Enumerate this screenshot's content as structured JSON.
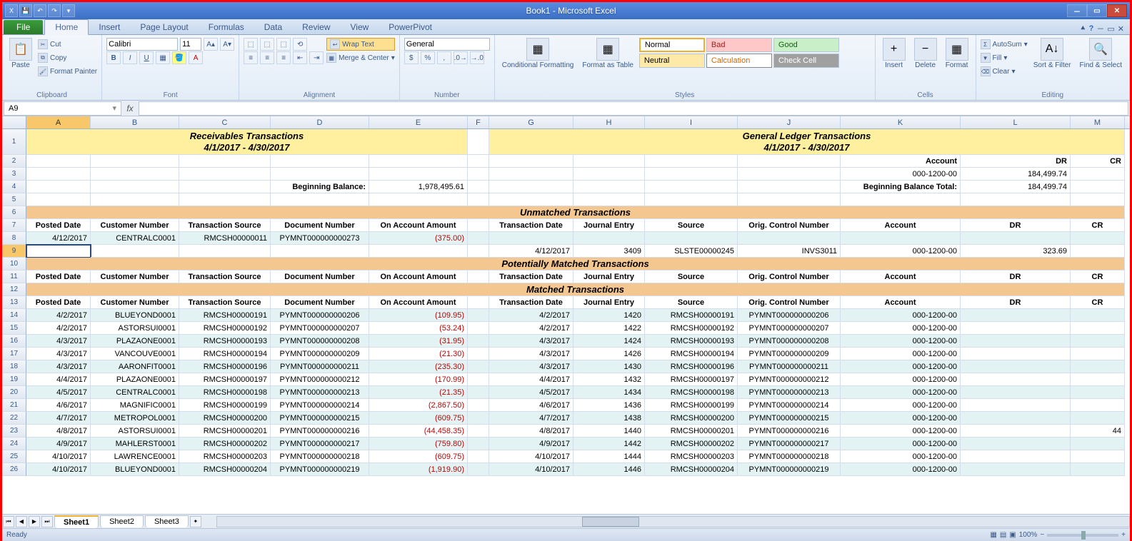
{
  "app": {
    "title": "Book1 - Microsoft Excel"
  },
  "qat": [
    "save",
    "undo",
    "redo",
    "print",
    "quick"
  ],
  "ribbon": {
    "tabs": [
      "File",
      "Home",
      "Insert",
      "Page Layout",
      "Formulas",
      "Data",
      "Review",
      "View",
      "PowerPivot"
    ],
    "activeTab": "Home",
    "clipboard": {
      "paste": "Paste",
      "cut": "Cut",
      "copy": "Copy",
      "fmt": "Format Painter",
      "label": "Clipboard"
    },
    "font": {
      "name": "Calibri",
      "size": "11",
      "label": "Font"
    },
    "alignment": {
      "wrap": "Wrap Text",
      "merge": "Merge & Center",
      "label": "Alignment"
    },
    "number": {
      "fmt": "General",
      "label": "Number"
    },
    "styles": {
      "cond": "Conditional Formatting",
      "table": "Format as Table",
      "s1": "Normal",
      "s2": "Bad",
      "s3": "Good",
      "s4": "Neutral",
      "s5": "Calculation",
      "s6": "Check Cell",
      "label": "Styles"
    },
    "cells": {
      "ins": "Insert",
      "del": "Delete",
      "fmt": "Format",
      "label": "Cells"
    },
    "editing": {
      "sum": "AutoSum",
      "fill": "Fill",
      "clear": "Clear",
      "sort": "Sort & Filter",
      "find": "Find & Select",
      "label": "Editing"
    }
  },
  "namebox": "A9",
  "columns": [
    "A",
    "B",
    "C",
    "D",
    "E",
    "F",
    "G",
    "H",
    "I",
    "J",
    "K",
    "L",
    "M"
  ],
  "selected": {
    "col": "A",
    "row": 9
  },
  "headers": {
    "recvTitle": "Receivables Transactions",
    "recvDates": "4/1/2017 - 4/30/2017",
    "glTitle": "General Ledger Transactions",
    "glDates": "4/1/2017 - 4/30/2017",
    "account": "Account",
    "dr": "DR",
    "cr": "CR",
    "acctNum": "000-1200-00",
    "drVal": "184,499.74",
    "begBal": "Beginning Balance:",
    "begBalVal": "1,978,495.61",
    "begBalTot": "Beginning Balance Total:",
    "begBalTotVal": "184,499.74",
    "unmatched": "Unmatched Transactions",
    "potmatched": "Potentially Matched Transactions",
    "matched": "Matched Transactions",
    "rc": [
      "Posted Date",
      "Customer Number",
      "Transaction Source",
      "Document Number",
      "On Account Amount"
    ],
    "gc": [
      "Transaction Date",
      "Journal Entry",
      "Source",
      "Orig. Control Number",
      "Account",
      "DR",
      "CR"
    ]
  },
  "unmatchedRows": {
    "r8": {
      "a": "4/12/2017",
      "b": "CENTRALC0001",
      "c": "RMCSH00000011",
      "d": "PYMNT000000000273",
      "e": "(375.00)"
    },
    "r9": {
      "g": "4/12/2017",
      "h": "3409",
      "i": "SLSTE00000245",
      "j": "INVS3011",
      "k": "000-1200-00",
      "l": "323.69"
    }
  },
  "matchedRows": [
    {
      "a": "4/2/2017",
      "b": "BLUEYOND0001",
      "c": "RMCSH00000191",
      "d": "PYMNT000000000206",
      "e": "(109.95)",
      "g": "4/2/2017",
      "h": "1420",
      "i": "RMCSH00000191",
      "j": "PYMNT000000000206",
      "k": "000-1200-00"
    },
    {
      "a": "4/2/2017",
      "b": "ASTORSUI0001",
      "c": "RMCSH00000192",
      "d": "PYMNT000000000207",
      "e": "(53.24)",
      "g": "4/2/2017",
      "h": "1422",
      "i": "RMCSH00000192",
      "j": "PYMNT000000000207",
      "k": "000-1200-00"
    },
    {
      "a": "4/3/2017",
      "b": "PLAZAONE0001",
      "c": "RMCSH00000193",
      "d": "PYMNT000000000208",
      "e": "(31.95)",
      "g": "4/3/2017",
      "h": "1424",
      "i": "RMCSH00000193",
      "j": "PYMNT000000000208",
      "k": "000-1200-00"
    },
    {
      "a": "4/3/2017",
      "b": "VANCOUVE0001",
      "c": "RMCSH00000194",
      "d": "PYMNT000000000209",
      "e": "(21.30)",
      "g": "4/3/2017",
      "h": "1426",
      "i": "RMCSH00000194",
      "j": "PYMNT000000000209",
      "k": "000-1200-00"
    },
    {
      "a": "4/3/2017",
      "b": "AARONFIT0001",
      "c": "RMCSH00000196",
      "d": "PYMNT000000000211",
      "e": "(235.30)",
      "g": "4/3/2017",
      "h": "1430",
      "i": "RMCSH00000196",
      "j": "PYMNT000000000211",
      "k": "000-1200-00"
    },
    {
      "a": "4/4/2017",
      "b": "PLAZAONE0001",
      "c": "RMCSH00000197",
      "d": "PYMNT000000000212",
      "e": "(170.99)",
      "g": "4/4/2017",
      "h": "1432",
      "i": "RMCSH00000197",
      "j": "PYMNT000000000212",
      "k": "000-1200-00"
    },
    {
      "a": "4/5/2017",
      "b": "CENTRALC0001",
      "c": "RMCSH00000198",
      "d": "PYMNT000000000213",
      "e": "(21.35)",
      "g": "4/5/2017",
      "h": "1434",
      "i": "RMCSH00000198",
      "j": "PYMNT000000000213",
      "k": "000-1200-00"
    },
    {
      "a": "4/6/2017",
      "b": "MAGNIFIC0001",
      "c": "RMCSH00000199",
      "d": "PYMNT000000000214",
      "e": "(2,867.50)",
      "g": "4/6/2017",
      "h": "1436",
      "i": "RMCSH00000199",
      "j": "PYMNT000000000214",
      "k": "000-1200-00"
    },
    {
      "a": "4/7/2017",
      "b": "METROPOL0001",
      "c": "RMCSH00000200",
      "d": "PYMNT000000000215",
      "e": "(609.75)",
      "g": "4/7/2017",
      "h": "1438",
      "i": "RMCSH00000200",
      "j": "PYMNT000000000215",
      "k": "000-1200-00"
    },
    {
      "a": "4/8/2017",
      "b": "ASTORSUI0001",
      "c": "RMCSH00000201",
      "d": "PYMNT000000000216",
      "e": "(44,458.35)",
      "g": "4/8/2017",
      "h": "1440",
      "i": "RMCSH00000201",
      "j": "PYMNT000000000216",
      "k": "000-1200-00",
      "m": "44"
    },
    {
      "a": "4/9/2017",
      "b": "MAHLERST0001",
      "c": "RMCSH00000202",
      "d": "PYMNT000000000217",
      "e": "(759.80)",
      "g": "4/9/2017",
      "h": "1442",
      "i": "RMCSH00000202",
      "j": "PYMNT000000000217",
      "k": "000-1200-00"
    },
    {
      "a": "4/10/2017",
      "b": "LAWRENCE0001",
      "c": "RMCSH00000203",
      "d": "PYMNT000000000218",
      "e": "(609.75)",
      "g": "4/10/2017",
      "h": "1444",
      "i": "RMCSH00000203",
      "j": "PYMNT000000000218",
      "k": "000-1200-00"
    },
    {
      "a": "4/10/2017",
      "b": "BLUEYOND0001",
      "c": "RMCSH00000204",
      "d": "PYMNT000000000219",
      "e": "(1,919.90)",
      "g": "4/10/2017",
      "h": "1446",
      "i": "RMCSH00000204",
      "j": "PYMNT000000000219",
      "k": "000-1200-00"
    }
  ],
  "sheets": [
    "Sheet1",
    "Sheet2",
    "Sheet3"
  ],
  "status": {
    "ready": "Ready",
    "zoom": "100%"
  }
}
